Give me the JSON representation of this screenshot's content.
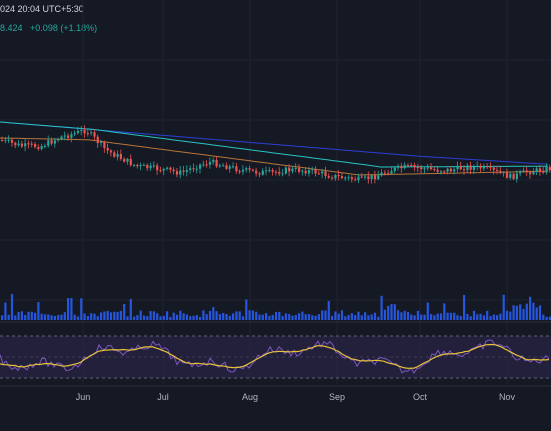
{
  "header": {
    "datetime_text": "024 20:04 UTC+5:30",
    "price_text": "8.424",
    "change_text": "+0.098 (+1.18%)"
  },
  "colors": {
    "background": "#151924",
    "bull": "#26a69a",
    "bear": "#ef5350",
    "volume": "#2962ff",
    "ma_teal": "#26c6c0",
    "ma_blue": "#2b3fd6",
    "ma_orange": "#b8763a",
    "rsi_line": "#7e57c2",
    "rsi_ma": "#e6c23a",
    "rsi_band": "#2a2446",
    "grid": "#1e2230"
  },
  "x_axis": {
    "labels": [
      "Jun",
      "Jul",
      "Aug",
      "Sep",
      "Oct",
      "Nov"
    ]
  },
  "chart_data": {
    "type": "candlestick",
    "title": "",
    "x_categories": [
      "Jun",
      "Jul",
      "Aug",
      "Sep",
      "Oct",
      "Nov"
    ],
    "candles_description": "Daily candles: rise to a local high around early June, gradual decline through July–September, flat-to-slightly-rising consolidation October–November",
    "rsi": {
      "upper_band": 70,
      "lower_band": 30,
      "midline": 50
    }
  }
}
